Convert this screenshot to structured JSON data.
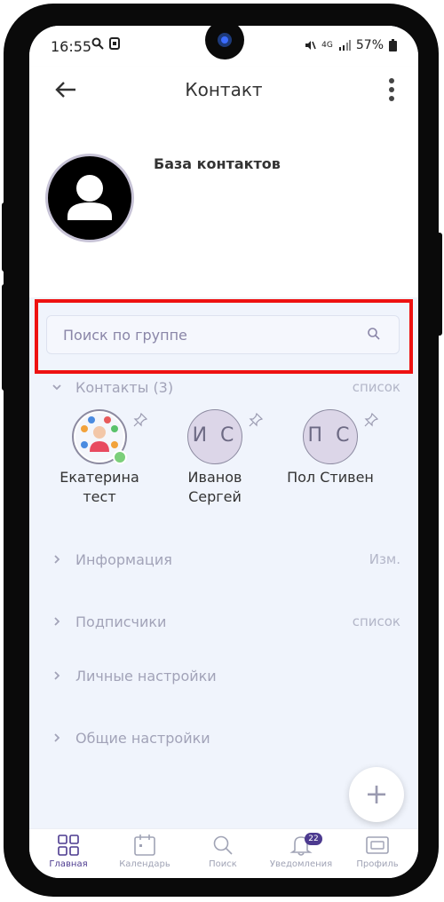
{
  "status_bar": {
    "time": "16:55",
    "network": "4G",
    "battery": "57%"
  },
  "app_bar": {
    "title": "Контакт",
    "back_icon": "arrow-left-icon",
    "menu_icon": "more-vertical-icon"
  },
  "header": {
    "title": "База контактов",
    "avatar_icon": "person-icon"
  },
  "search": {
    "placeholder": "Поиск по группе",
    "icon": "search-icon"
  },
  "contacts_section": {
    "label": "Контакты (3)",
    "action": "список",
    "expanded": true,
    "items": [
      {
        "name_line1": "Екатерина",
        "name_line2": "тест",
        "initials": "",
        "has_photo": true,
        "online": true
      },
      {
        "name_line1": "Иванов",
        "name_line2": "Сергей",
        "initials": "И С",
        "has_photo": false
      },
      {
        "name_line1": "Пол Стивен",
        "name_line2": "",
        "initials": "П С",
        "has_photo": false
      }
    ]
  },
  "sections": [
    {
      "label": "Информация",
      "action": "Изм."
    },
    {
      "label": "Подписчики",
      "action": "список"
    },
    {
      "label": "Личные настройки",
      "action": ""
    },
    {
      "label": "Общие настройки",
      "action": ""
    }
  ],
  "fab": {
    "label": "+"
  },
  "bottom_nav": {
    "items": [
      {
        "label": "Главная",
        "icon": "grid-icon",
        "active": true
      },
      {
        "label": "Календарь",
        "icon": "calendar-icon",
        "active": false
      },
      {
        "label": "Поиск",
        "icon": "search-icon",
        "active": false
      },
      {
        "label": "Уведомления",
        "icon": "bell-icon",
        "active": false,
        "badge": "22"
      },
      {
        "label": "Профиль",
        "icon": "profile-card-icon",
        "active": false
      }
    ]
  },
  "colors": {
    "accent": "#4c3a8f",
    "highlight": "#ee1111",
    "background": "#f0f4fc"
  }
}
